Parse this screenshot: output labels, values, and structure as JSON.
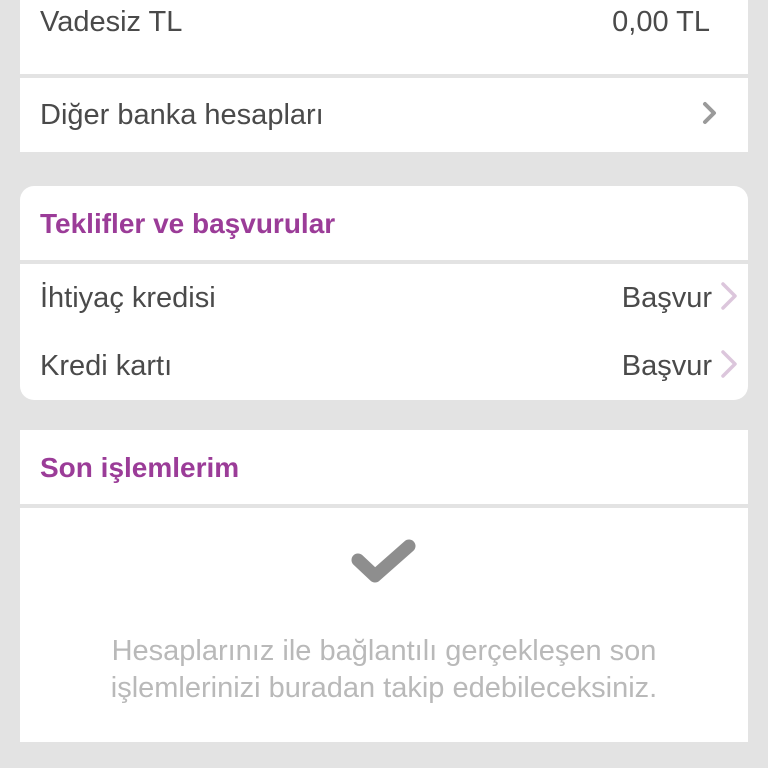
{
  "accounts": {
    "vadesiz_label": "Vadesiz TL",
    "vadesiz_amount": "0,00 TL",
    "other_banks_label": "Diğer banka hesapları"
  },
  "offers": {
    "title": "Teklifler ve başvurular",
    "items": [
      {
        "label": "İhtiyaç kredisi",
        "action": "Başvur"
      },
      {
        "label": "Kredi kartı",
        "action": "Başvur"
      }
    ]
  },
  "recent": {
    "title": "Son işlemlerim",
    "empty_line1": "Hesaplarınız ile bağlantılı gerçekleşen son",
    "empty_line2": "işlemlerinizi buradan takip edebileceksiniz."
  },
  "colors": {
    "accent": "#9b3c98",
    "chevron_light": "#dcc6dc",
    "chevron_gray": "#9a9a9a",
    "background": "#e3e3e3"
  }
}
